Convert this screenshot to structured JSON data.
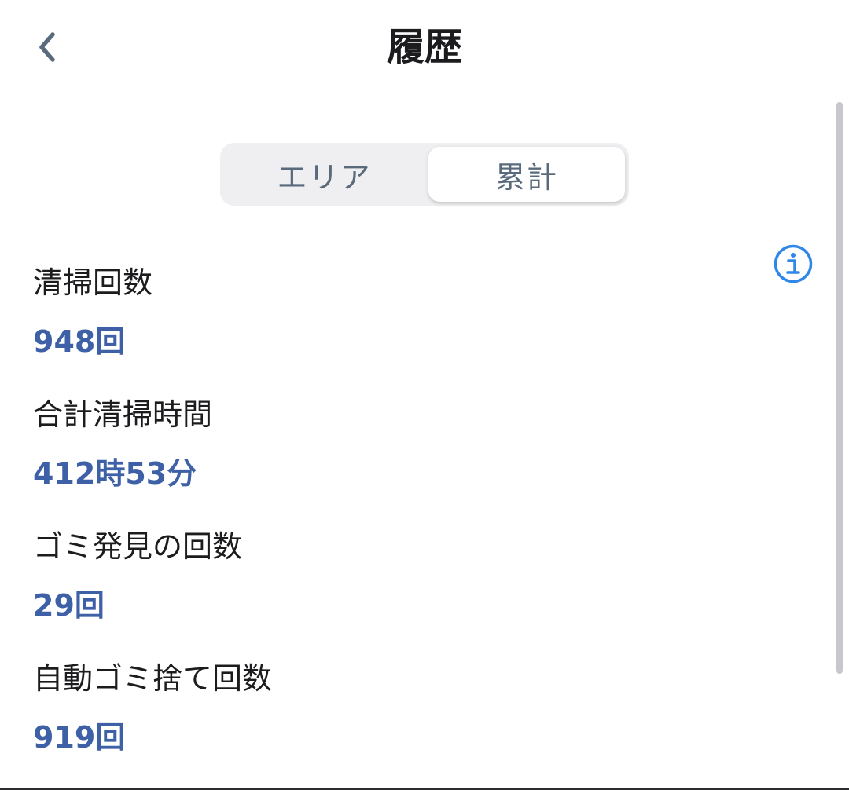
{
  "header": {
    "title": "履歴",
    "back_icon": "chevron-left-icon"
  },
  "tabs": [
    {
      "label": "エリア",
      "selected": false
    },
    {
      "label": "累計",
      "selected": true
    }
  ],
  "info_icon": "info-circle-icon",
  "stats": [
    {
      "label": "清掃回数",
      "value": "948回"
    },
    {
      "label": "合計清掃時間",
      "value": "412時53分"
    },
    {
      "label": "ゴミ発見の回数",
      "value": "29回"
    },
    {
      "label": "自動ゴミ捨て回数",
      "value": "919回"
    }
  ],
  "colors": {
    "accent": "#3d60a6",
    "info": "#2f87e8",
    "back": "#5a6a7d"
  }
}
